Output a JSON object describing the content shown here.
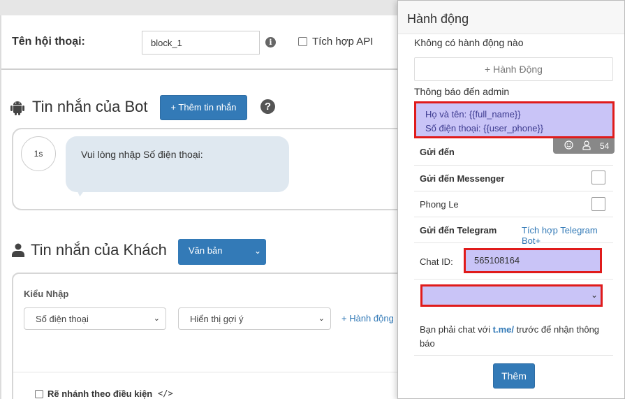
{
  "editor": {
    "name_label": "Tên hội thoại:",
    "name_value": "block_1",
    "api_label": "Tích hợp API",
    "bot_section_title": "Tin nhắn của Bot",
    "add_message_button": "+ Thêm tin nhắn",
    "delay": "1s",
    "bot_message": "Vui lòng nhập Số điện thoại:",
    "user_section_title": "Tin nhắn của Khách",
    "message_type": "Văn bản",
    "input_kind_label": "Kiểu Nhập",
    "input_kind_value": "Số điện thoại",
    "hint_value": "Hiển thị gợi ý",
    "action_link": "+ Hành động",
    "branch_label": "Rẽ nhánh theo điều kiện",
    "code_icon": "</>"
  },
  "panel": {
    "title": "Hành động",
    "no_actions": "Không có hành động nào",
    "add_action_button": "+ Hành Động",
    "notify_label": "Thông báo đến admin",
    "notify_line_1": "Họ và tên: {{full_name}}",
    "notify_line_2": "Số điện thoại: {{user_phone}}",
    "toolbar_count": "54",
    "send_to_label": "Gửi đến",
    "messenger_label": "Gửi đến Messenger",
    "user_name": "Phong Le",
    "telegram_label": "Gửi đến Telegram",
    "telegram_link": "Tích hợp Telegram Bot+",
    "chat_id_label": "Chat ID:",
    "chat_id_value": "565108164",
    "note_prefix": "Bạn phải chat với ",
    "note_link": "t.me/",
    "note_suffix": " trước để nhận thông báo",
    "add_button": "Thêm"
  },
  "colors": {
    "primary": "#337ab7",
    "highlight_fill": "#c9c4f7",
    "highlight_border": "#e01b1b",
    "bubble": "#dfe8f0"
  },
  "icons": [
    "info-icon",
    "android-icon",
    "help-icon",
    "user-icon",
    "emoji-icon",
    "person-icon",
    "chevron-down-icon",
    "code-icon"
  ]
}
